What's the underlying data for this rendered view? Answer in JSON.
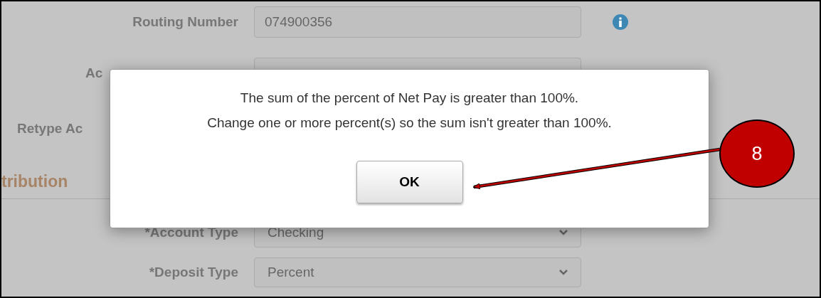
{
  "form": {
    "rows": [
      {
        "label": "Routing Number",
        "value": "074900356",
        "kind": "text_info"
      },
      {
        "label": "Ac",
        "kind": "partial_field"
      },
      {
        "label": "Retype Ac",
        "kind": "partial"
      }
    ],
    "section_title": "tribution",
    "rows2": [
      {
        "label": "*Account Type",
        "value": "Checking",
        "kind": "select"
      },
      {
        "label": "*Deposit Type",
        "value": "Percent",
        "kind": "select"
      }
    ]
  },
  "dialog": {
    "lines": [
      "The sum of the percent of Net Pay is greater than 100%.",
      "Change one or more percent(s) so the sum isn't greater than 100%."
    ],
    "button": "OK"
  },
  "callout": {
    "number": "8"
  }
}
